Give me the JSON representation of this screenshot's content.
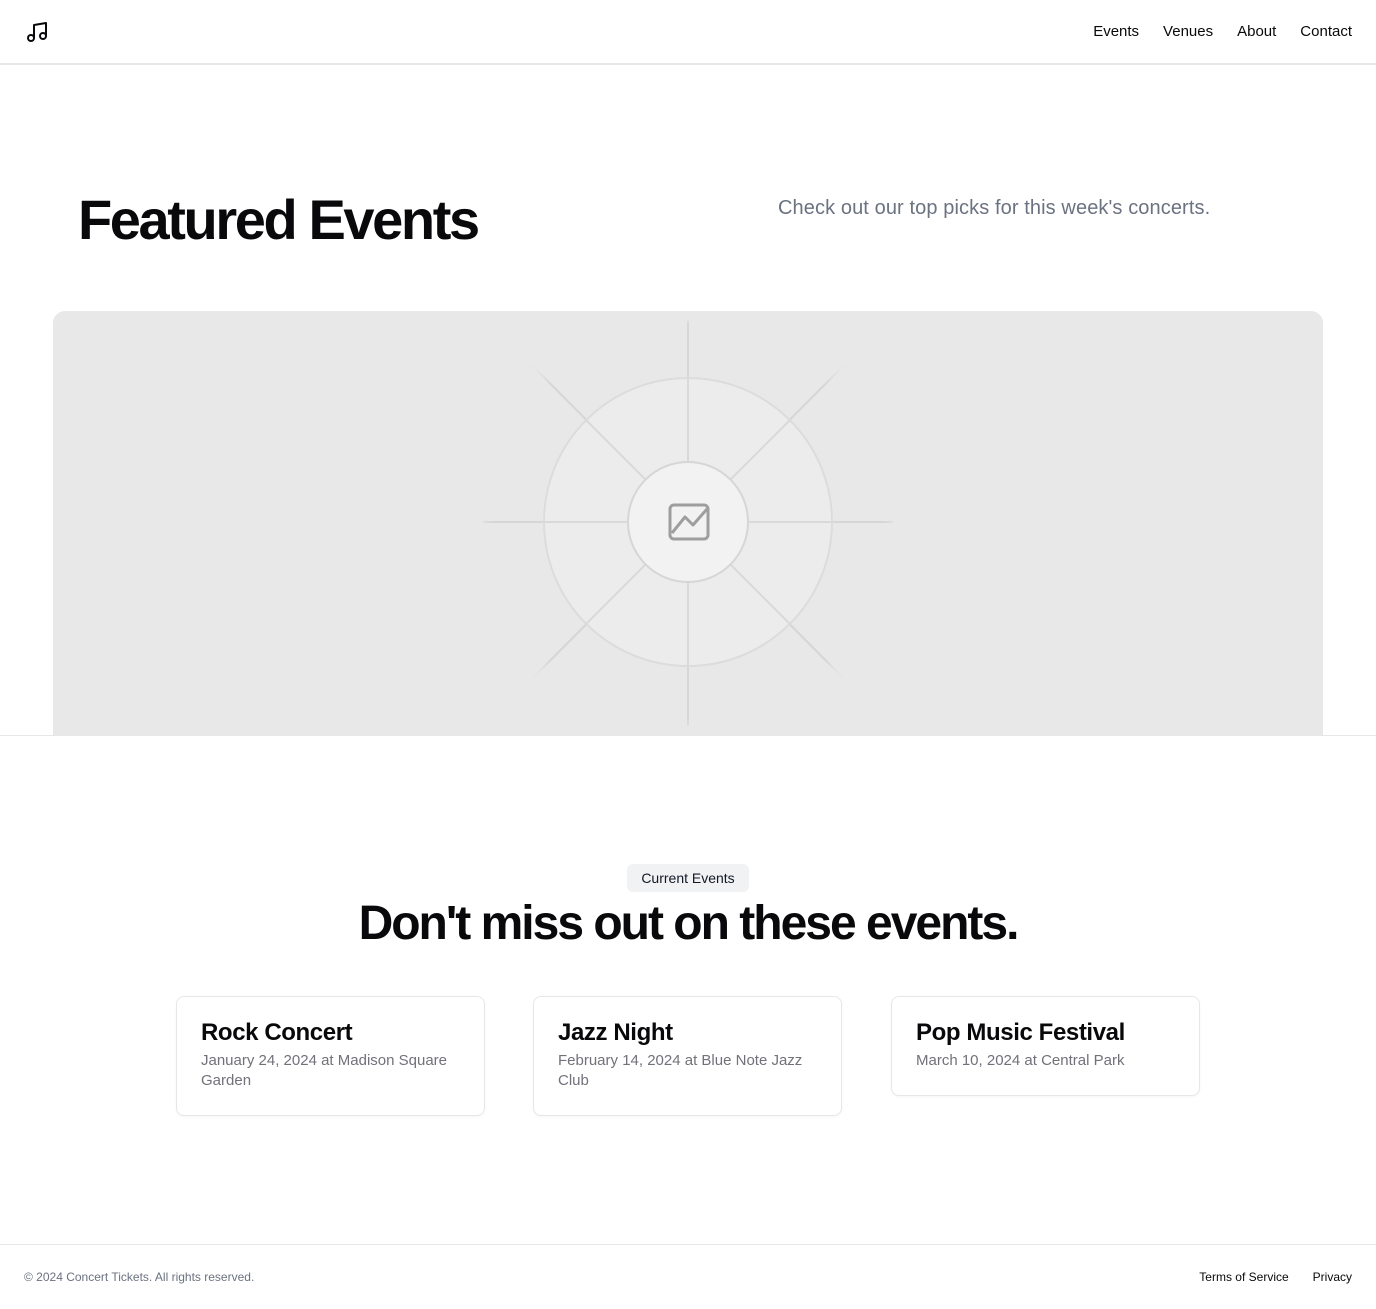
{
  "header": {
    "logo_icon": "music-note-icon",
    "nav": [
      {
        "label": "Events"
      },
      {
        "label": "Venues"
      },
      {
        "label": "About"
      },
      {
        "label": "Contact"
      }
    ]
  },
  "hero": {
    "title": "Featured Events",
    "subtitle": "Check out our top picks for this week's concerts.",
    "image_icon": "image-placeholder-icon"
  },
  "events_section": {
    "badge": "Current Events",
    "title": "Don't miss out on these events.",
    "cards": [
      {
        "title": "Rock Concert",
        "details": "January 24, 2024 at Madison Square Garden"
      },
      {
        "title": "Jazz Night",
        "details": "February 14, 2024 at Blue Note Jazz Club"
      },
      {
        "title": "Pop Music Festival",
        "details": "March 10, 2024 at Central Park"
      }
    ]
  },
  "footer": {
    "copyright": "© 2024 Concert Tickets. All rights reserved.",
    "links": [
      {
        "label": "Terms of Service"
      },
      {
        "label": "Privacy"
      }
    ]
  },
  "colors": {
    "text_primary": "#09090b",
    "text_muted": "#6b7280",
    "placeholder_bg": "#e8e8e8",
    "border": "#e5e7eb"
  }
}
